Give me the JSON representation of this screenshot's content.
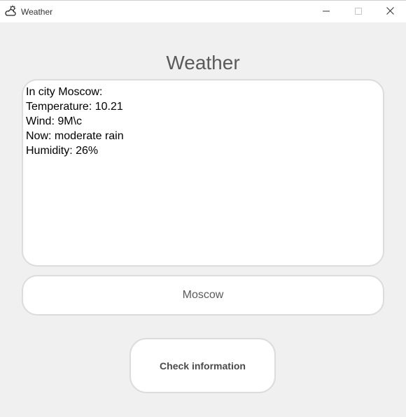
{
  "window": {
    "title": "Weather",
    "icon": "cloud-sun-icon"
  },
  "titlebar_buttons": {
    "minimize_icon": "minimize-icon",
    "maximize_icon": "maximize-icon",
    "close_icon": "close-icon"
  },
  "main": {
    "heading": "Weather",
    "output_lines": [
      "In city Moscow:",
      "Temperature: 10.21",
      "Wind: 9M\\c",
      "Now: moderate rain",
      "Humidity: 26%"
    ],
    "city_input_value": "Moscow",
    "check_button_label": "Check information"
  },
  "colors": {
    "background": "#f0f0f0",
    "panel": "#ffffff",
    "border": "#dcdcdc",
    "heading_text": "#5a5a5a"
  }
}
